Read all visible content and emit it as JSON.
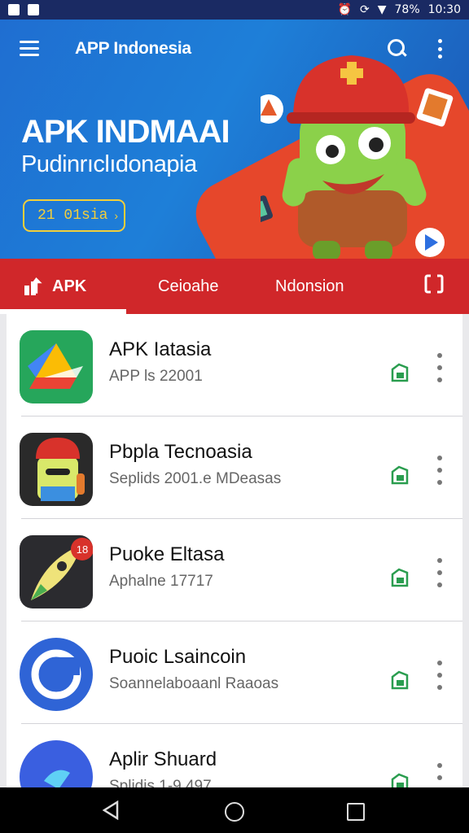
{
  "status_bar": {
    "battery": "78%",
    "time": "10:30"
  },
  "appbar": {
    "title": "APP Indonesia"
  },
  "hero": {
    "headline": "APK INDMAAI",
    "subtitle": "Pudinrıclıdonapia",
    "button_label": "21 01sia",
    "button_arrow": "›"
  },
  "tabs": [
    {
      "label": "APK"
    },
    {
      "label": "Ceioahe"
    },
    {
      "label": "Ndonsion"
    }
  ],
  "apps": [
    {
      "name": "APK Iatasia",
      "meta": "APP ls 22001"
    },
    {
      "name": "Pbpla Tecnoasia",
      "meta": "Seplids 2001.e MDeasas"
    },
    {
      "name": "Puoke Eltasa",
      "meta": "Aphalne 17717",
      "badge": "18"
    },
    {
      "name": "Puoic Lsaincoin",
      "meta": "Soannelaboaanl Raaoas"
    },
    {
      "name": "Aplir Shuard",
      "meta": "Splidis 1-9 497"
    }
  ],
  "colors": {
    "tabbar": "#d0272a",
    "hero": "#1f6ed1",
    "install": "#2a9d4f"
  }
}
